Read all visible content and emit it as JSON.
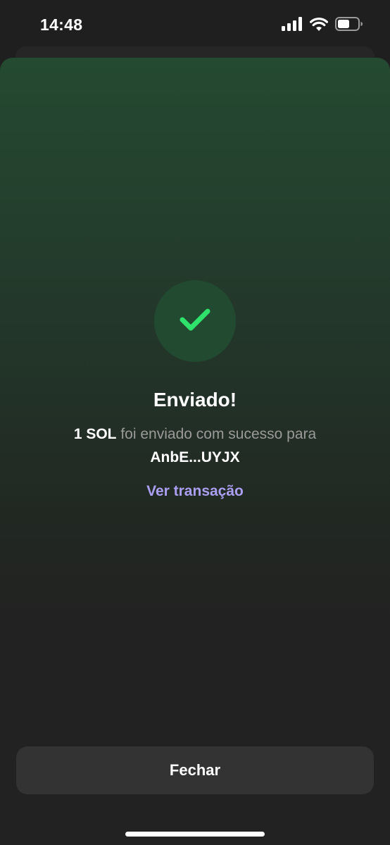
{
  "status_bar": {
    "time": "14:48",
    "icons": [
      "cellular-signal-icon",
      "wifi-icon",
      "battery-icon"
    ],
    "battery_level": 0.6
  },
  "modal": {
    "icon": "checkmark-icon",
    "title": "Enviado!",
    "message": {
      "amount": "1 SOL",
      "text": " foi enviado com sucesso para ",
      "recipient": "AnbE...UYJX"
    },
    "view_transaction_label": "Ver transação",
    "close_label": "Fechar"
  },
  "colors": {
    "accent_green": "#2ee26b",
    "link_purple": "#ab9ff2",
    "background": "#222222",
    "button_bg": "#333333"
  }
}
